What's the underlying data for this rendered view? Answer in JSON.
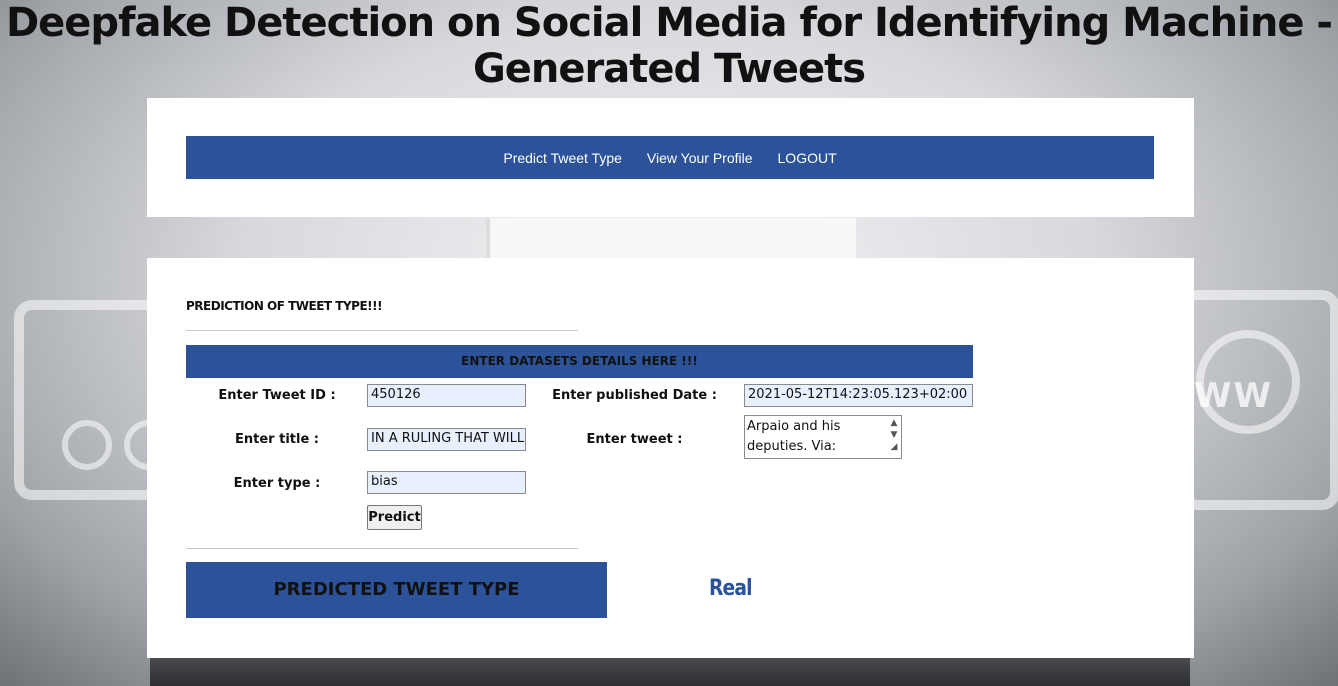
{
  "page": {
    "title": "Deepfake Detection on Social Media for Identifying Machine - Generated Tweets"
  },
  "nav": {
    "items": [
      "Predict Tweet Type",
      "View Your Profile",
      "LOGOUT"
    ]
  },
  "form": {
    "section_title": "PREDICTION OF TWEET TYPE!!!",
    "header": "ENTER DATASETS DETAILS HERE !!!",
    "tweet_id_label": "Enter Tweet ID :",
    "tweet_id_value": "450126",
    "published_date_label": "Enter published Date :",
    "published_date_value": "2021-05-12T14:23:05.123+02:00",
    "title_label": "Enter title :",
    "title_value": "IN A RULING THAT WILL M",
    "tweet_label": "Enter tweet :",
    "tweet_value": "Arpaio and his deputies. Via: Reuters",
    "type_label": "Enter type :",
    "type_value": "bias",
    "predict_button": "Predict"
  },
  "result": {
    "label": "PREDICTED TWEET TYPE",
    "value": "Real"
  },
  "colors": {
    "accent": "#2c539a"
  }
}
